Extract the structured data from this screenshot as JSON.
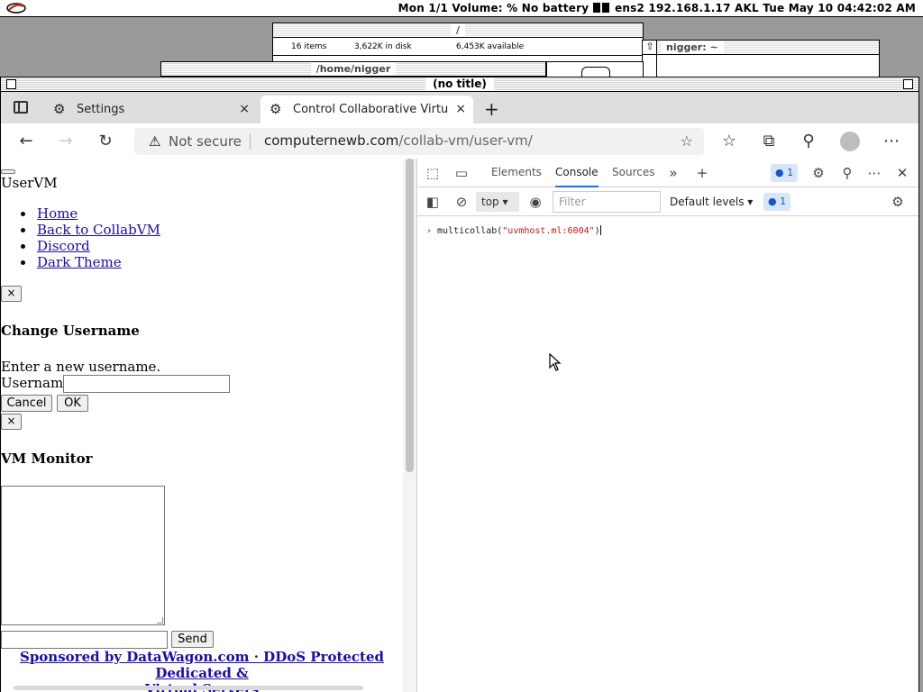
{
  "system_bar": {
    "status_left": "Mon 1/1 Volume: % No battery",
    "status_right": "ens2 192.168.1.17 AKL Tue May 10 04:42:02 AM"
  },
  "background_windows": {
    "file_manager": {
      "title": "/",
      "items": "16 items",
      "disk": "3,622K in disk",
      "available": "6,453K available"
    },
    "home_window": {
      "title": "/home/nigger"
    },
    "terminal_window": {
      "title": "nigger: ~"
    }
  },
  "main_window": {
    "title": "(no title)"
  },
  "browser": {
    "tabs": [
      {
        "label": "Settings",
        "icon": "gear-icon",
        "close": "×"
      },
      {
        "label": "Control Collaborative Virtu",
        "icon": "page-icon",
        "close": "×"
      }
    ],
    "new_tab": "+",
    "address": {
      "security": "Not secure",
      "host": "computernewb.com",
      "path": "/collab-vm/user-vm/"
    }
  },
  "page": {
    "heading": "UserVM",
    "nav": [
      "Home",
      "Back to CollabVM",
      "Discord",
      "Dark Theme"
    ],
    "close_label": "×",
    "change_username": {
      "title": "Change Username",
      "prompt": "Enter a new username.",
      "field_label": "Username",
      "field_value": "",
      "cancel": "Cancel",
      "ok": "OK"
    },
    "vm_monitor": {
      "title": "VM Monitor",
      "send": "Send"
    },
    "sponsor": {
      "line1": "Sponsored by DataWagon.com · DDoS Protected Dedicated &",
      "line2": "Virtual Servers"
    }
  },
  "devtools": {
    "tabs": [
      "Elements",
      "Console",
      "Sources"
    ],
    "active_tab": "Console",
    "issue_count": "1",
    "context": "top",
    "filter_placeholder": "Filter",
    "levels": "Default levels",
    "console_input": {
      "prefix": "multicollab(",
      "string": "\"uvmhost.ml:6004\"",
      "suffix": ")"
    }
  }
}
